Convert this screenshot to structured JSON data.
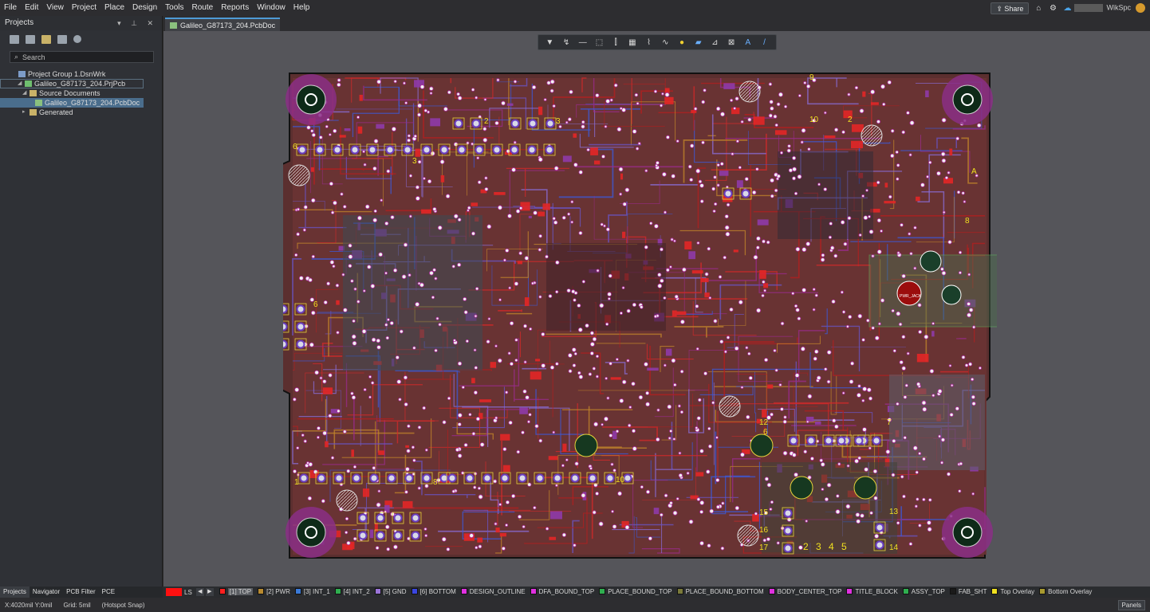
{
  "menu": [
    "File",
    "Edit",
    "View",
    "Project",
    "Place",
    "Design",
    "Tools",
    "Route",
    "Reports",
    "Window",
    "Help"
  ],
  "topright": {
    "share_label": "Share",
    "workspace_label": "WikSpc"
  },
  "projects_panel": {
    "title": "Projects",
    "search_placeholder": "Search",
    "tree": [
      {
        "label": "Project Group 1.DsnWrk",
        "level": 0,
        "icon": "workspace-icon"
      },
      {
        "label": "Galileo_G87173_204.PrjPcb",
        "level": 1,
        "icon": "pcb-project-icon"
      },
      {
        "label": "Source Documents",
        "level": 2,
        "icon": "folder-icon"
      },
      {
        "label": "Galileo_G87173_204.PcbDoc",
        "level": 3,
        "icon": "pcb-doc-icon"
      },
      {
        "label": "Generated",
        "level": 2,
        "icon": "folder-icon"
      }
    ],
    "tabs": [
      "Projects",
      "Navigator",
      "PCB Filter",
      "PCE"
    ]
  },
  "doc_tab": {
    "label": "Galileo_G87173_204.PcbDoc"
  },
  "active_bar_icons": [
    "filter-icon",
    "route-icon",
    "line-icon",
    "select-rect-icon",
    "align-icon",
    "component-icon",
    "interactive-route-icon",
    "diff-pair-icon",
    "via-icon",
    "polygon-icon",
    "dimension-icon",
    "string-text-icon",
    "text-icon",
    "line-draw-icon"
  ],
  "board_labels": {
    "hdr_top_left": "6",
    "hdr_top_right": "3",
    "hdr_top_2": "2",
    "hdr_top_3": "3",
    "conn_9": "9",
    "conn_10": "10",
    "conn_2": "2",
    "ftdi_a": "A",
    "hdr8": "8",
    "pwr_label": "PWR_JACK",
    "left6": "6",
    "left3": "3",
    "bot12": "12",
    "bot6": "6",
    "bot7": "7",
    "bot10": "10",
    "bot8": "8",
    "bot1": "1",
    "bot16": "16",
    "bot15": "15",
    "bot17": "17",
    "bot13": "13",
    "bot14": "14",
    "btm_nums": "2 3 4 5"
  },
  "layers": [
    {
      "label": "[1] TOP",
      "color": "#ff2020"
    },
    {
      "label": "[2] PWR",
      "color": "#b88a30"
    },
    {
      "label": "[3] INT_1",
      "color": "#3a7ad8"
    },
    {
      "label": "[4] INT_2",
      "color": "#2fae4f"
    },
    {
      "label": "[5] GND",
      "color": "#9a74d8"
    },
    {
      "label": "[6] BOTTOM",
      "color": "#3a46e0"
    },
    {
      "label": "DESIGN_OUTLINE",
      "color": "#e031e0"
    },
    {
      "label": "DFA_BOUND_TOP",
      "color": "#e031e0"
    },
    {
      "label": "PLACE_BOUND_TOP",
      "color": "#2fae4f"
    },
    {
      "label": "PLACE_BOUND_BOTTOM",
      "color": "#7a7a3a"
    },
    {
      "label": "BODY_CENTER_TOP",
      "color": "#e031e0"
    },
    {
      "label": "TITLE_BLOCK",
      "color": "#e031e0"
    },
    {
      "label": "ASSY_TOP",
      "color": "#2fae4f"
    },
    {
      "label": "FAB_SHT",
      "color": "#1a1a1a"
    },
    {
      "label": "Top Overlay",
      "color": "#f0e020"
    },
    {
      "label": "Bottom Overlay",
      "color": "#a89a30"
    }
  ],
  "layer_set_label": "LS",
  "status": {
    "coords": "X:4020mil Y:0mil",
    "grid": "Grid: 5mil",
    "snap": "(Hotspot Snap)",
    "panels": "Panels"
  }
}
